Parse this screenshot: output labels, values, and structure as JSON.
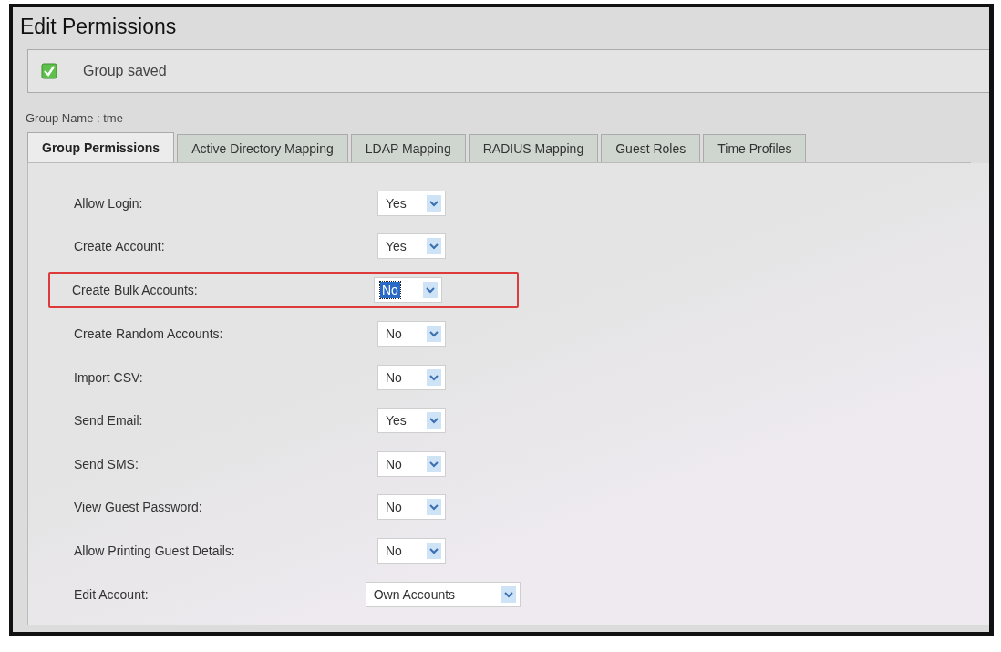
{
  "window": {
    "title": "Edit Permissions"
  },
  "message": {
    "kind": "success",
    "text": "Group saved"
  },
  "group_name": "Group Name : tme",
  "tabs": [
    {
      "label": "Group Permissions",
      "selected": true
    },
    {
      "label": "Active Directory Mapping",
      "selected": false
    },
    {
      "label": "LDAP Mapping",
      "selected": false
    },
    {
      "label": "RADIUS Mapping",
      "selected": false
    },
    {
      "label": "Guest Roles",
      "selected": false
    },
    {
      "label": "Time Profiles",
      "selected": false
    }
  ],
  "fields": [
    {
      "label": "Allow Login:",
      "value": "Yes",
      "highlighted": false,
      "focused": false,
      "kind": "short"
    },
    {
      "label": "Create Account:",
      "value": "Yes",
      "highlighted": false,
      "focused": false,
      "kind": "short"
    },
    {
      "label": "Create Bulk Accounts:",
      "value": "No",
      "highlighted": true,
      "focused": true,
      "kind": "short"
    },
    {
      "label": "Create Random Accounts:",
      "value": "No",
      "highlighted": false,
      "focused": false,
      "kind": "short"
    },
    {
      "label": "Import CSV:",
      "value": "No",
      "highlighted": false,
      "focused": false,
      "kind": "short"
    },
    {
      "label": "Send Email:",
      "value": "Yes",
      "highlighted": false,
      "focused": false,
      "kind": "short"
    },
    {
      "label": "Send SMS:",
      "value": "No",
      "highlighted": false,
      "focused": false,
      "kind": "short"
    },
    {
      "label": "View Guest Password:",
      "value": "No",
      "highlighted": false,
      "focused": false,
      "kind": "short"
    },
    {
      "label": "Allow Printing Guest Details:",
      "value": "No",
      "highlighted": false,
      "focused": false,
      "kind": "short"
    },
    {
      "label": "Edit Account:",
      "value": "Own Accounts",
      "highlighted": false,
      "focused": false,
      "kind": "wide"
    }
  ]
}
